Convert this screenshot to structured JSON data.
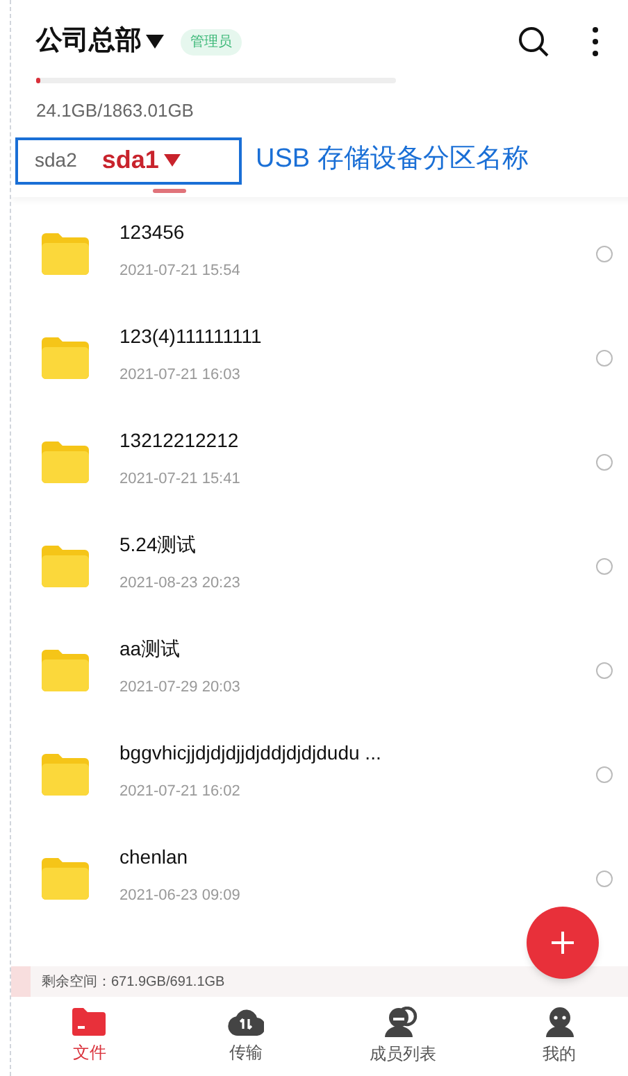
{
  "header": {
    "title": "公司总部",
    "role_badge": "管理员"
  },
  "storage": {
    "level": 0.013,
    "reading": "24.1GB/1863.01GB"
  },
  "partition_tabs": [
    {
      "label": "sda2",
      "selected": false
    },
    {
      "label": "sda1",
      "selected": true
    }
  ],
  "annotation": "USB 存储设备分区名称",
  "files": [
    {
      "name": "123456",
      "date": "2021-07-21 15:54",
      "checked": false
    },
    {
      "name": "123(4)111111111",
      "date": "2021-07-21 16:03",
      "checked": false
    },
    {
      "name": "13212212212",
      "date": "2021-07-21 15:41",
      "checked": false
    },
    {
      "name": "5.24测试",
      "date": "2021-08-23 20:23",
      "checked": false
    },
    {
      "name": "aa测试",
      "date": "2021-07-29 20:03",
      "checked": false
    },
    {
      "name": "bggvhicjjdjdjdjjdjddjdjdjdudu ...",
      "date": "2021-07-21 16:02",
      "checked": false
    },
    {
      "name": "chenlan",
      "date": "2021-06-23 09:09",
      "checked": false
    }
  ],
  "free_space": {
    "label": "剩余空间：671.9GB/691.1GB",
    "level": 0.03
  },
  "nav": [
    {
      "label": "文件",
      "kind": "files",
      "selected": true
    },
    {
      "label": "传输",
      "kind": "transfer",
      "selected": false
    },
    {
      "label": "成员列表",
      "kind": "members",
      "selected": false
    },
    {
      "label": "我的",
      "kind": "me",
      "selected": false
    }
  ]
}
